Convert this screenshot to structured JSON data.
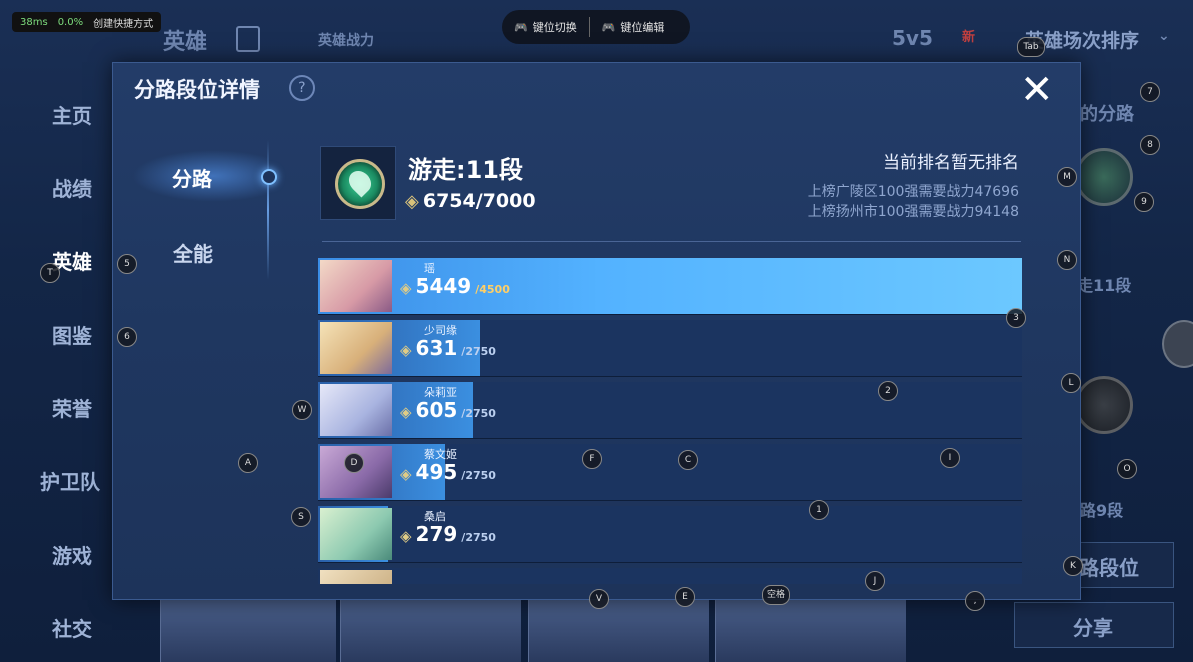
{
  "perf": {
    "ms": "38ms",
    "pct": "0.0%",
    "shortcut": "创建快捷方式"
  },
  "keybar": {
    "switch": "键位切换",
    "edit": "键位编辑"
  },
  "background": {
    "nav": [
      "主页",
      "战绩",
      "英雄",
      "图鉴",
      "荣誉",
      "护卫队",
      "游戏",
      "社交"
    ],
    "top_hero": "英雄",
    "top_power": "英雄战力",
    "mode": "5v5",
    "new_badge": "新",
    "sort": "英雄场次排序",
    "right_lane": "的分路",
    "right_rank": "走11段",
    "right_rank2": "路9段",
    "lane_rank_btn": "路段位",
    "share_btn": "分享"
  },
  "dialog": {
    "title": "分路段位详情",
    "help": "?",
    "close": "✕",
    "tabs": [
      {
        "label": "分路",
        "active": true
      },
      {
        "label": "全能",
        "active": false
      }
    ],
    "rank_title": "游走:11段",
    "power": "6754/7000",
    "rank_status": "当前排名暂无排名",
    "requirements": [
      "上榜广陵区100强需要战力47696",
      "上榜扬州市100强需要战力94148"
    ],
    "heroes": [
      {
        "name": "瑶",
        "score": "5449",
        "max": "/4500",
        "fill": 1.0
      },
      {
        "name": "少司缘",
        "score": "631",
        "max": "/2750",
        "fill": 0.23
      },
      {
        "name": "朵莉亚",
        "score": "605",
        "max": "/2750",
        "fill": 0.22
      },
      {
        "name": "蔡文姬",
        "score": "495",
        "max": "/2750",
        "fill": 0.18
      },
      {
        "name": "桑启",
        "score": "279",
        "max": "/2750",
        "fill": 0.1
      }
    ]
  },
  "key_hints": [
    "Tab",
    "7",
    "8",
    "9",
    "M",
    "N",
    "L",
    "O",
    "K",
    "T",
    "5",
    "6",
    "W",
    "A",
    "S",
    "D",
    "F",
    "C",
    "I",
    "1",
    "2",
    "3",
    "V",
    "E",
    "空格",
    "J",
    ","
  ],
  "colors": {
    "accent": "#53b2ff",
    "gold": "#e0cc86"
  }
}
